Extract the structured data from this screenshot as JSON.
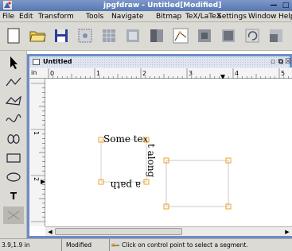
{
  "window": {
    "title": "jpgfdraw - Untitled[Modified]",
    "minimize_glyph": "—",
    "maximize_glyph": "□"
  },
  "menubar": {
    "items": [
      "File",
      "Edit",
      "Transform",
      "Tools",
      "Navigate",
      "Bitmap",
      "TeX/LaTeX",
      "Settings",
      "Window",
      "Help"
    ]
  },
  "toolbar": {
    "buttons": [
      "new-file-icon",
      "open-folder-icon",
      "save-disk-icon",
      "select-all-icon",
      "grid-icon",
      "image-icon",
      "path-edit-icon",
      "move-front-icon",
      "move-back-icon",
      "rotate-icon",
      "scale-icon"
    ]
  },
  "palette": {
    "tools": [
      "select-arrow-icon",
      "open-line-icon",
      "closed-line-icon",
      "open-curve-icon",
      "closed-curve-icon",
      "rectangle-icon",
      "ellipse-icon",
      "text-tool",
      "math-text-icon"
    ],
    "text_tool_label": "T"
  },
  "document": {
    "name": "Untitled",
    "ruler_unit": "in",
    "h_ruler_labels": [
      "0",
      "1",
      "2",
      "3",
      "4",
      "5"
    ],
    "v_ruler_labels": [
      "1",
      "2"
    ]
  },
  "canvas": {
    "text_on_path_parts": [
      "Some tex",
      "t along",
      "a path"
    ]
  },
  "statusbar": {
    "coordinates": "3.9,1.9 in",
    "modified": "Modified",
    "message": "Click on control point to select a segment."
  },
  "colors": {
    "title_bar": "#5a7ab5",
    "frame_border": "#6c8cc8",
    "control_points": "#f0a020",
    "chrome": "#dcdad5"
  }
}
